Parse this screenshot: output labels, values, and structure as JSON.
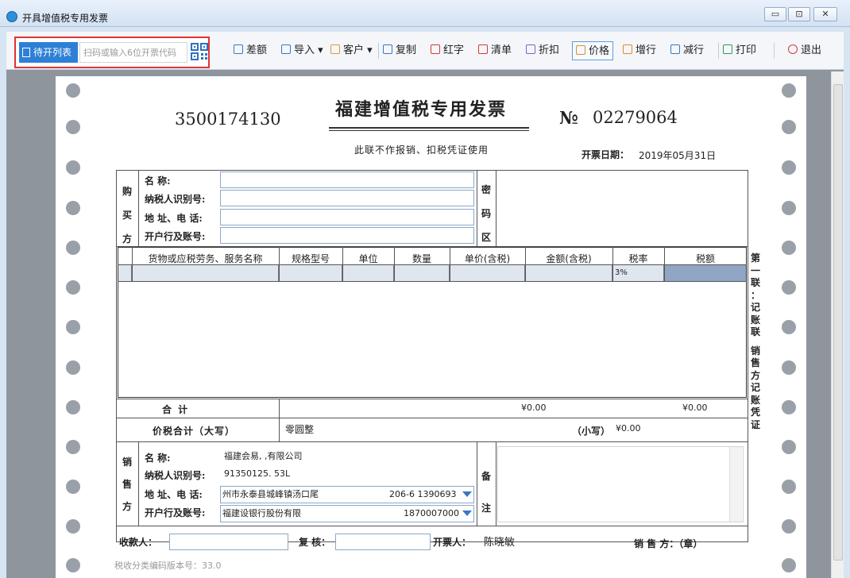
{
  "window": {
    "title": "开具增值税专用发票",
    "controls": [
      "▭",
      "⊡",
      "✕"
    ]
  },
  "toolbar": {
    "pending_label": "待开列表",
    "scan_placeholder": "扫码或输入6位开票代码",
    "buttons": [
      "差额",
      "导入",
      "客户",
      "复制",
      "红字",
      "清单",
      "折扣",
      "价格",
      "增行",
      "减行",
      "打印",
      "退出"
    ],
    "selected": "价格"
  },
  "invoice": {
    "code": "3500174130",
    "title": "福建增值税专用发票",
    "no_symbol": "№",
    "number": "02279064",
    "subtitle": "此联不作报销、扣税凭证使用",
    "date_label": "开票日期：",
    "date": "2019年05月31日",
    "buyer": {
      "section_label": [
        "购",
        "买",
        "方"
      ],
      "name_label": "名      称:",
      "taxid_label": "纳税人识别号:",
      "address_label": "地  址、电  话:",
      "bank_label": "开户行及账号:"
    },
    "password_label": [
      "密",
      "码",
      "区"
    ],
    "table_headers": [
      "货物或应税劳务、服务名称",
      "规格型号",
      "单位",
      "数量",
      "单价(含税)",
      "金额(含税)",
      "税率",
      "税额"
    ],
    "row1_tax_rate": "3%",
    "total_label": "合      计",
    "total_amount": "¥0.00",
    "total_tax": "¥0.00",
    "amount_words_label": "价税合计（大写）",
    "amount_words": "零圆整",
    "amount_small_label": "（小写）",
    "amount_small": "¥0.00",
    "seller": {
      "section_label": [
        "销",
        "售",
        "方"
      ],
      "name_label": "名      称:",
      "name_value": "福建会易,            ,有限公司",
      "taxid_label": "纳税人识别号:",
      "taxid_value": "91350125.          53L",
      "address_label": "地  址、电  话:",
      "address_value": "州市永泰县城峰镇汤口尾",
      "address_phone": "206-6  1390693",
      "bank_label": "开户行及账号:",
      "bank_value": "福建设银行股份有限",
      "bank_account": "1870007000"
    },
    "remarks_label": [
      "备",
      "注"
    ],
    "side_label": [
      "第",
      "一",
      "联",
      "：",
      "记",
      "账",
      "联",
      "",
      "销",
      "售",
      "方",
      "记",
      "账",
      "凭",
      "证"
    ],
    "payee_label": "收款人：",
    "reviewer_label": "复 核：",
    "drawer_label": "开票人：",
    "drawer_name": "陈晓敏",
    "seller_stamp_label": "销  售  方：（章）",
    "version": "税收分类编码版本号：33.0"
  }
}
